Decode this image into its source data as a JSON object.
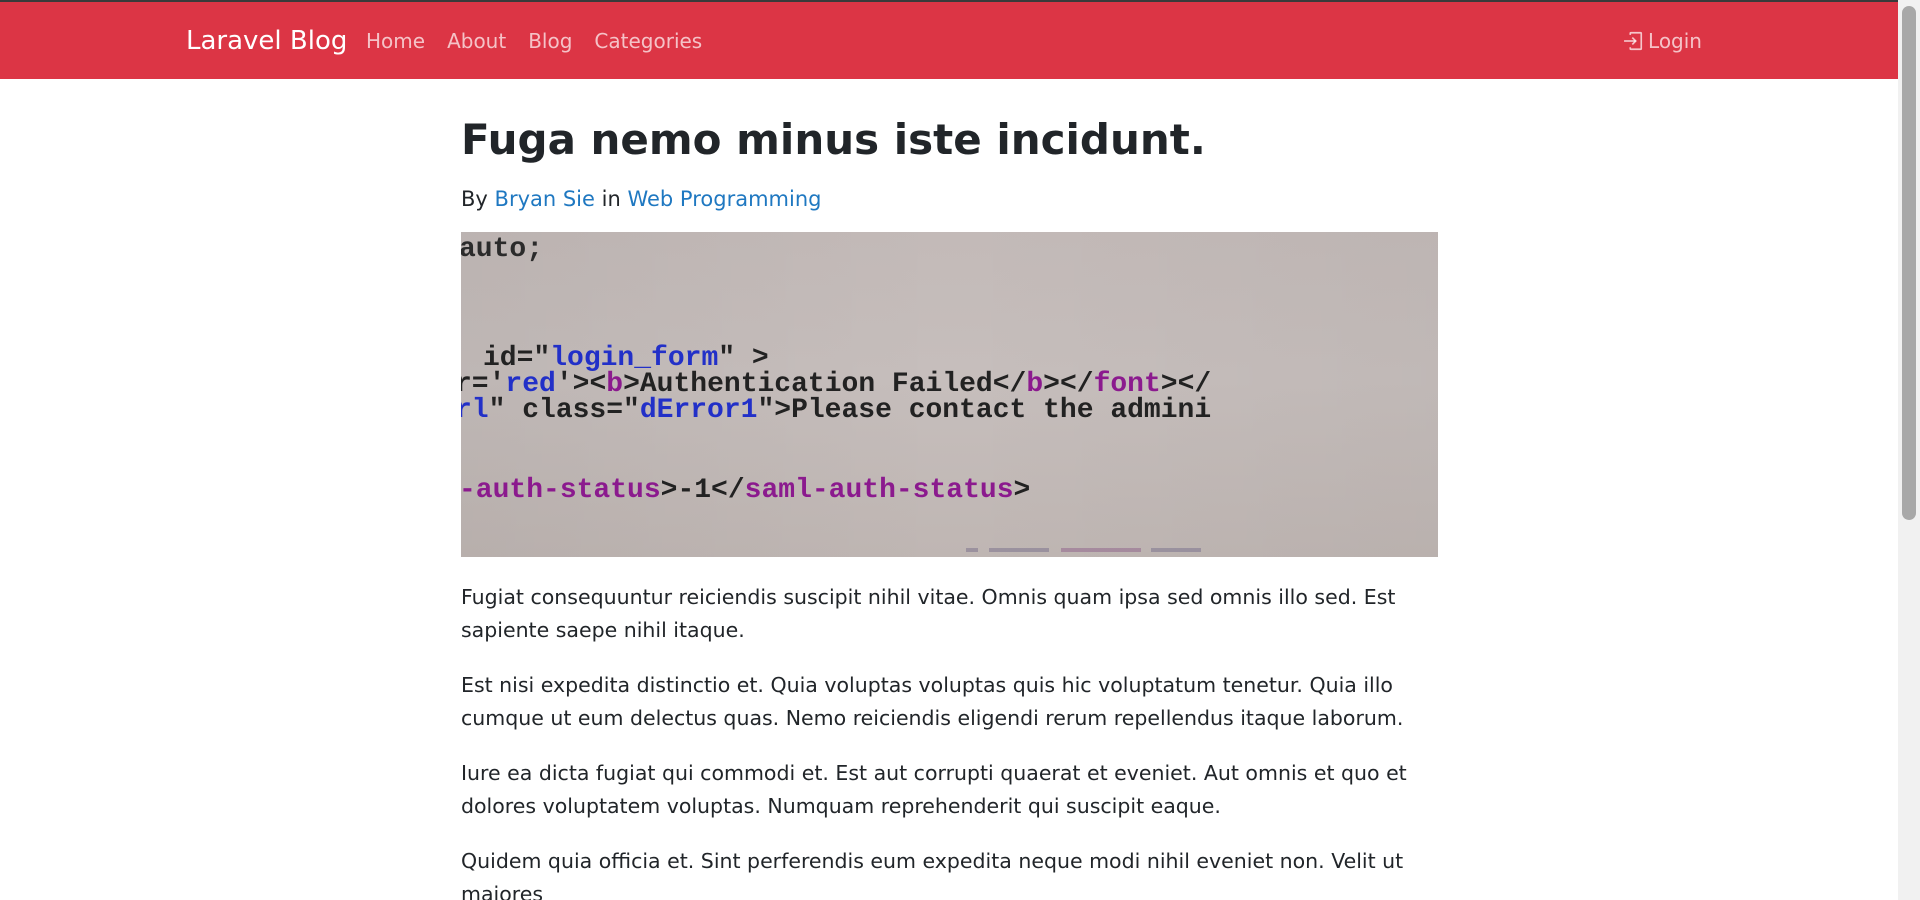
{
  "navbar": {
    "brand": "Laravel Blog",
    "links": [
      "Home",
      "About",
      "Blog",
      "Categories"
    ],
    "login_label": "Login",
    "color": "#dc3545"
  },
  "article": {
    "title": "Fuga nemo minus iste incidunt.",
    "by_prefix": "By",
    "author": "Bryan Sie",
    "in_word": "in",
    "category": "Web Programming",
    "image": {
      "lines": [
        "auto;",
        "id=\"login_form\" >",
        "r='red'><b>Authentication Failed</b></font></",
        "rl\" class=\"dError1\">Please contact the admini",
        "-auth-status>-1</saml-auth-status>"
      ]
    },
    "paragraphs": [
      "Fugiat consequuntur reiciendis suscipit nihil vitae. Omnis quam ipsa sed omnis illo sed. Est sapiente saepe nihil itaque.",
      "Est nisi expedita distinctio et. Quia voluptas voluptas quis hic voluptatum tenetur. Quia illo cumque ut eum delectus quas. Nemo reiciendis eligendi rerum repellendus itaque laborum.",
      "Iure ea dicta fugiat qui commodi et. Est aut corrupti quaerat et eveniet. Aut omnis et quo et dolores voluptatem voluptas. Numquam reprehenderit qui suscipit eaque.",
      "Quidem quia officia et. Sint perferendis eum expedita neque modi nihil eveniet non. Velit ut maiores"
    ]
  }
}
